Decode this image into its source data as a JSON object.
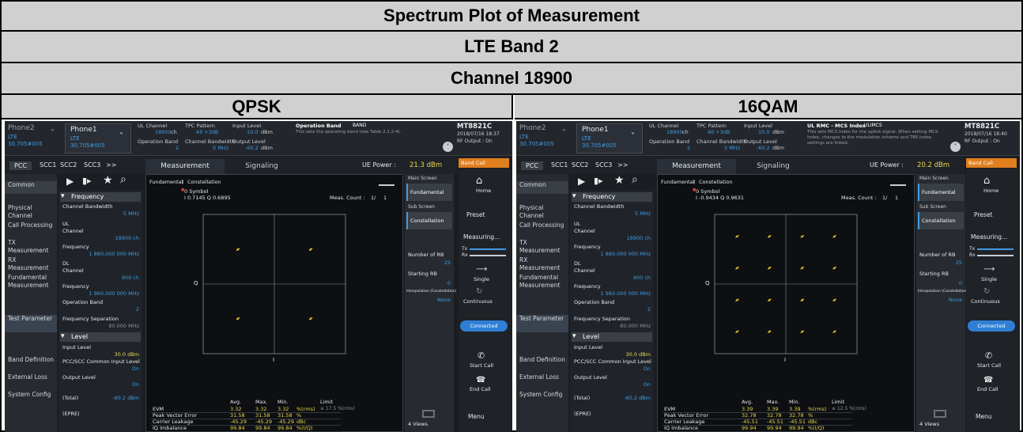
{
  "header": {
    "title": "Spectrum Plot of Measurement",
    "band": "LTE Band 2",
    "channel": "Channel 18900",
    "col_left": "QPSK",
    "col_right": "16QAM"
  },
  "panels": [
    {
      "phone2": "Phone2",
      "phone2_sub": "LTE",
      "phone2_id": "30.705#005",
      "phone1": "Phone1",
      "phone1_sub": "LTE",
      "phone1_id": "30.705#005",
      "ul_channel_label": "UL Channel",
      "ul_channel_val": "18900",
      "ul_channel_unit": "ch",
      "tpc_label": "TPC Pattern",
      "tpc_val": "All +3dB",
      "input_level_label": "Input Level",
      "input_level_val": "10.0",
      "input_level_unit": "dBm",
      "op_band_label": "Operation Band",
      "op_band_val": "2",
      "ch_bw_label": "Channel Bandwidth",
      "ch_bw_val": "5 MHz",
      "out_level_label": "Output Level",
      "out_level_val": "-60.2",
      "out_level_unit": "dBm",
      "info_title": "Operation Band",
      "info_tag": "BAND",
      "info_text": "This sets the operating band (see Table 2.1.2-4).",
      "instrument": "MT8821C",
      "datetime": "2018/07/16 18:37",
      "rf_output": "RF Output : On",
      "tabs": [
        "PCC",
        "SCC1",
        "SCC2",
        "SCC3",
        ">>"
      ],
      "main_tab1": "Measurement",
      "main_tab2": "Signaling",
      "ue_power_label": "UE Power :",
      "ue_power_val": "21.3 dBm",
      "band_call": "Band Call",
      "sidebar": [
        "Common",
        "Physical Channel",
        "Call Processing",
        "TX Measurement",
        "RX Measurement",
        "Fundamental Measurement",
        "Test Parameter",
        "Band Definition",
        "External Loss",
        "System Config"
      ],
      "freq_header": "Frequency",
      "ch_bw_param": "Channel Bandwidth",
      "ch_bw_param_val": "5 MHz",
      "ul": "UL",
      "channel": "Channel",
      "ul_channel": "18900 ch",
      "frequency": "Frequency",
      "ul_freq": "1 880.000 000 MHz",
      "dl": "DL",
      "dl_channel": "900 ch",
      "dl_freq": "1 960.000 000 MHz",
      "op_band_param": "Operation Band",
      "op_band_param_val": "2",
      "freq_sep": "Frequency Separation",
      "freq_sep_val": "80.000 MHz",
      "level_header": "Level",
      "input_level_param": "Input Level",
      "input_level_param_val": "30.0 dBm",
      "pcc_scc": "PCC/SCC Common Input Level",
      "on1": "On",
      "output_level_param": "Output Level",
      "on2": "On",
      "total": "(Total)",
      "total_val": "-60.2 dBm",
      "epre": "(EPRE)",
      "breadcrumb1": "Fundamental",
      "breadcrumb2": "Constellation",
      "symbol": "0 Symbol",
      "iq": "I 0.7145 Q 0.6895",
      "meas_count_label": "Meas. Count :",
      "meas_count": "1/",
      "meas_count2": "1",
      "axis_q": "Q",
      "axis_i": "I",
      "main_screen": "Main Screen",
      "fundamental": "Fundamental",
      "sub_screen": "Sub Screen",
      "constellation": "Constellation",
      "num_rb": "Number of RB",
      "num_rb_val": "25",
      "start_rb": "Starting RB",
      "start_rb_val": "0",
      "interp": "Interpolation (Constellation)",
      "interp_val": "None",
      "views": "4 Views",
      "home": "Home",
      "preset": "Preset",
      "measuring": "Measuring...",
      "tx": "Tx",
      "rx": "Rx",
      "single": "Single",
      "continuous": "Continuous",
      "connected": "Connected",
      "start_call": "Start Call",
      "end_call": "End Call",
      "menu": "Menu",
      "res_cols": [
        "Avg.",
        "Max.",
        "Min.",
        "Limit"
      ],
      "res_rows": [
        {
          "name": "EVM",
          "avg": "3.32",
          "max": "3.32",
          "min": "3.32",
          "unit": "%(rms)",
          "limit": "≤ 17.5 %(rms)"
        },
        {
          "name": "Peak Vector Error",
          "avg": "31.58",
          "max": "31.58",
          "min": "31.58",
          "unit": "%",
          "limit": ""
        },
        {
          "name": "Carrier Leakage",
          "avg": "-45.29",
          "max": "-45.29",
          "min": "-45.29",
          "unit": "dBc",
          "limit": ""
        },
        {
          "name": "IQ Imbalance",
          "avg": "99.84",
          "max": "99.84",
          "min": "99.84",
          "unit": "%(I/Q)",
          "limit": ""
        }
      ]
    },
    {
      "phone2": "Phone2",
      "phone2_sub": "LTE",
      "phone2_id": "30.705#005",
      "phone1": "Phone1",
      "phone1_sub": "LTE",
      "phone1_id": "30.705#005",
      "ul_channel_label": "UL Channel",
      "ul_channel_val": "18900",
      "ul_channel_unit": "ch",
      "tpc_label": "TPC Pattern",
      "tpc_val": "All +3dB",
      "input_level_label": "Input Level",
      "input_level_val": "10.0",
      "input_level_unit": "dBm",
      "op_band_label": "Operation Band",
      "op_band_val": "2",
      "ch_bw_label": "Channel Bandwidth",
      "ch_bw_val": "5 MHz",
      "out_level_label": "Output Level",
      "out_level_val": "-60.2",
      "out_level_unit": "dBm",
      "info_title": "UL RMC - MCS Index",
      "info_tag": "ULIMCS",
      "info_text": "This sets MCS Index for the uplink signal. When setting MCS Index, changes to the modulation scheme and TBS Index settings are linked.",
      "instrument": "MT8821C",
      "datetime": "2018/07/16 18:40",
      "rf_output": "RF Output : On",
      "tabs": [
        "PCC",
        "SCC1",
        "SCC2",
        "SCC3",
        ">>"
      ],
      "main_tab1": "Measurement",
      "main_tab2": "Signaling",
      "ue_power_label": "UE Power :",
      "ue_power_val": "20.2 dBm",
      "band_call": "Band Call",
      "sidebar": [
        "Common",
        "Physical Channel",
        "Call Processing",
        "TX Measurement",
        "RX Measurement",
        "Fundamental Measurement",
        "Test Parameter",
        "Band Definition",
        "External Loss",
        "System Config"
      ],
      "freq_header": "Frequency",
      "ch_bw_param": "Channel Bandwidth",
      "ch_bw_param_val": "5 MHz",
      "ul": "UL",
      "channel": "Channel",
      "ul_channel": "18900 ch",
      "frequency": "Frequency",
      "ul_freq": "1 880.000 000 MHz",
      "dl": "DL",
      "dl_channel": "900 ch",
      "dl_freq": "1 960.000 000 MHz",
      "op_band_param": "Operation Band",
      "op_band_param_val": "2",
      "freq_sep": "Frequency Separation",
      "freq_sep_val": "80.000 MHz",
      "level_header": "Level",
      "input_level_param": "Input Level",
      "input_level_param_val": "30.0 dBm",
      "pcc_scc": "PCC/SCC Common Input Level",
      "on1": "On",
      "output_level_param": "Output Level",
      "on2": "On",
      "total": "(Total)",
      "total_val": "-60.2 dBm",
      "epre": "(EPRE)",
      "breadcrumb1": "Fundamental",
      "breadcrumb2": "Constellation",
      "symbol": "0 Symbol",
      "iq": "I -0.9434 Q 0.9631",
      "meas_count_label": "Meas. Count :",
      "meas_count": "1/",
      "meas_count2": "1",
      "axis_q": "Q",
      "axis_i": "I",
      "main_screen": "Main Screen",
      "fundamental": "Fundamental",
      "sub_screen": "Sub Screen",
      "constellation": "Constellation",
      "num_rb": "Number of RB",
      "num_rb_val": "25",
      "start_rb": "Starting RB",
      "start_rb_val": "0",
      "interp": "Interpolation (Constellation)",
      "interp_val": "None",
      "views": "4 Views",
      "home": "Home",
      "preset": "Preset",
      "measuring": "Measuring...",
      "tx": "Tx",
      "rx": "Rx",
      "single": "Single",
      "continuous": "Continuous",
      "connected": "Connected",
      "start_call": "Start Call",
      "end_call": "End Call",
      "menu": "Menu",
      "res_cols": [
        "Avg.",
        "Max.",
        "Min.",
        "Limit"
      ],
      "res_rows": [
        {
          "name": "EVM",
          "avg": "3.39",
          "max": "3.39",
          "min": "3.39",
          "unit": "%(rms)",
          "limit": "≤ 12.5 %(rms)"
        },
        {
          "name": "Peak Vector Error",
          "avg": "32.78",
          "max": "32.78",
          "min": "32.78",
          "unit": "%",
          "limit": ""
        },
        {
          "name": "Carrier Leakage",
          "avg": "-45.51",
          "max": "-45.51",
          "min": "-45.51",
          "unit": "dBc",
          "limit": ""
        },
        {
          "name": "IQ Imbalance",
          "avg": "99.94",
          "max": "99.94",
          "min": "99.94",
          "unit": "%(I/Q)",
          "limit": ""
        }
      ]
    }
  ],
  "constellations": [
    {
      "points": [
        [
          0.71,
          0.69
        ],
        [
          -0.71,
          0.69
        ],
        [
          -0.71,
          -0.69
        ],
        [
          0.71,
          -0.69
        ]
      ],
      "color": "#e8d030"
    },
    {
      "points": [
        [
          -0.95,
          0.95
        ],
        [
          -0.32,
          0.95
        ],
        [
          0.32,
          0.95
        ],
        [
          0.95,
          0.95
        ],
        [
          -0.95,
          0.32
        ],
        [
          -0.32,
          0.32
        ],
        [
          0.32,
          0.32
        ],
        [
          0.95,
          0.32
        ],
        [
          -0.95,
          -0.32
        ],
        [
          -0.32,
          -0.32
        ],
        [
          0.32,
          -0.32
        ],
        [
          0.95,
          -0.32
        ],
        [
          -0.95,
          -0.95
        ],
        [
          -0.32,
          -0.95
        ],
        [
          0.32,
          -0.95
        ],
        [
          0.95,
          -0.95
        ]
      ],
      "color": "#e8d030"
    }
  ],
  "colors": {
    "accent": "#3f9be0",
    "highlight": "#e8d84a",
    "connected": "#2f7fd6",
    "band_call": "#e07f1e"
  }
}
